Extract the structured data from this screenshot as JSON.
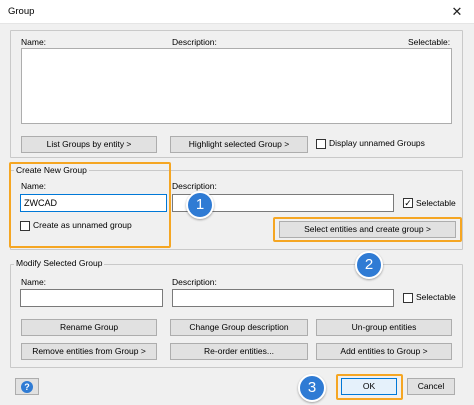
{
  "window": {
    "title": "Group",
    "close_glyph": "✕"
  },
  "groups_list": {
    "col_name": "Name:",
    "col_description": "Description:",
    "col_selectable": "Selectable:"
  },
  "list_buttons": {
    "list_groups": "List Groups by entity  >",
    "highlight": "Highlight selected Group  >",
    "display_unnamed": "Display unnamed Groups"
  },
  "create_group": {
    "legend": "Create New Group",
    "name_label": "Name:",
    "name_value": "ZWCAD",
    "description_label": "Description:",
    "description_value": "",
    "selectable_label": "Selectable",
    "selectable_checked": true,
    "unnamed_label": "Create as unnamed group",
    "select_button": "Select entities and create group  >"
  },
  "modify_group": {
    "legend": "Modify Selected Group",
    "name_label": "Name:",
    "name_value": "",
    "description_label": "Description:",
    "description_value": "",
    "selectable_label": "Selectable",
    "rename": "Rename Group",
    "change_desc": "Change Group description",
    "ungroup": "Un-group entities",
    "remove": "Remove entities from Group  >",
    "reorder": "Re-order entities...",
    "add": "Add entities to Group  >"
  },
  "footer": {
    "ok": "OK",
    "cancel": "Cancel",
    "help_glyph": "?"
  },
  "badges": {
    "b1": "1",
    "b2": "2",
    "b3": "3"
  },
  "colors": {
    "highlight": "#f5a623",
    "badge": "#2f7bd4",
    "help_icon": "#2f7bd4"
  }
}
